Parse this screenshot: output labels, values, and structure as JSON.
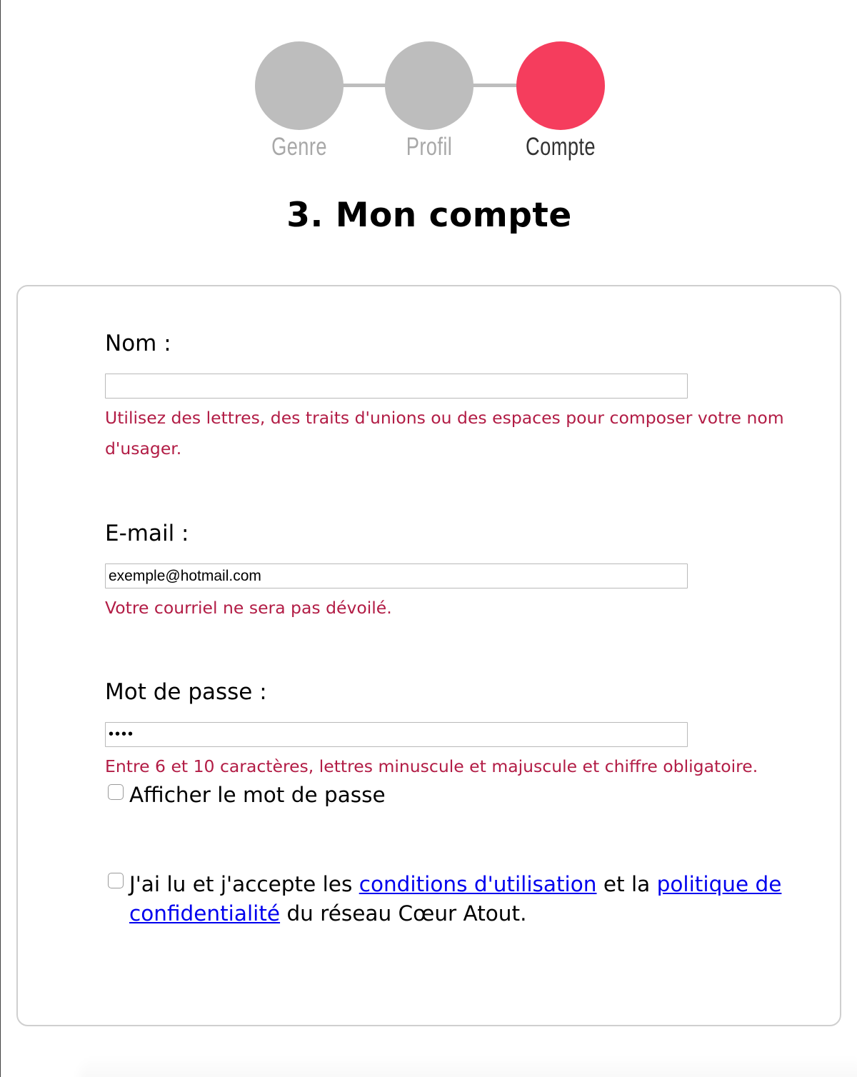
{
  "stepper": {
    "steps": [
      {
        "label": "Genre",
        "state": "done"
      },
      {
        "label": "Profil",
        "state": "done"
      },
      {
        "label": "Compte",
        "state": "active"
      }
    ],
    "colors": {
      "inactive": "#bdbdbd",
      "active": "#f53d5d"
    }
  },
  "page": {
    "title": "3. Mon compte"
  },
  "form": {
    "name": {
      "label": "Nom :",
      "value": "",
      "help": "Utilisez des lettres, des traits d'unions ou des espaces pour composer votre nom d'usager."
    },
    "email": {
      "label": "E-mail :",
      "value": "exemple@hotmail.com",
      "help": "Votre courriel ne sera pas dévoilé."
    },
    "password": {
      "label": "Mot de passe :",
      "value": "••••",
      "help": "Entre 6 et 10 caractères, lettres minuscule et majuscule et chiffre obligatoire.",
      "show_password_label": "Afficher le mot de passe",
      "show_password_checked": false
    },
    "terms": {
      "checked": false,
      "text_before": "J'ai lu et j'accepte les ",
      "terms_link": "conditions d'utilisation",
      "text_middle": " et la ",
      "privacy_link": "politique de confidentialité",
      "text_after": " du réseau Cœur Atout."
    }
  }
}
